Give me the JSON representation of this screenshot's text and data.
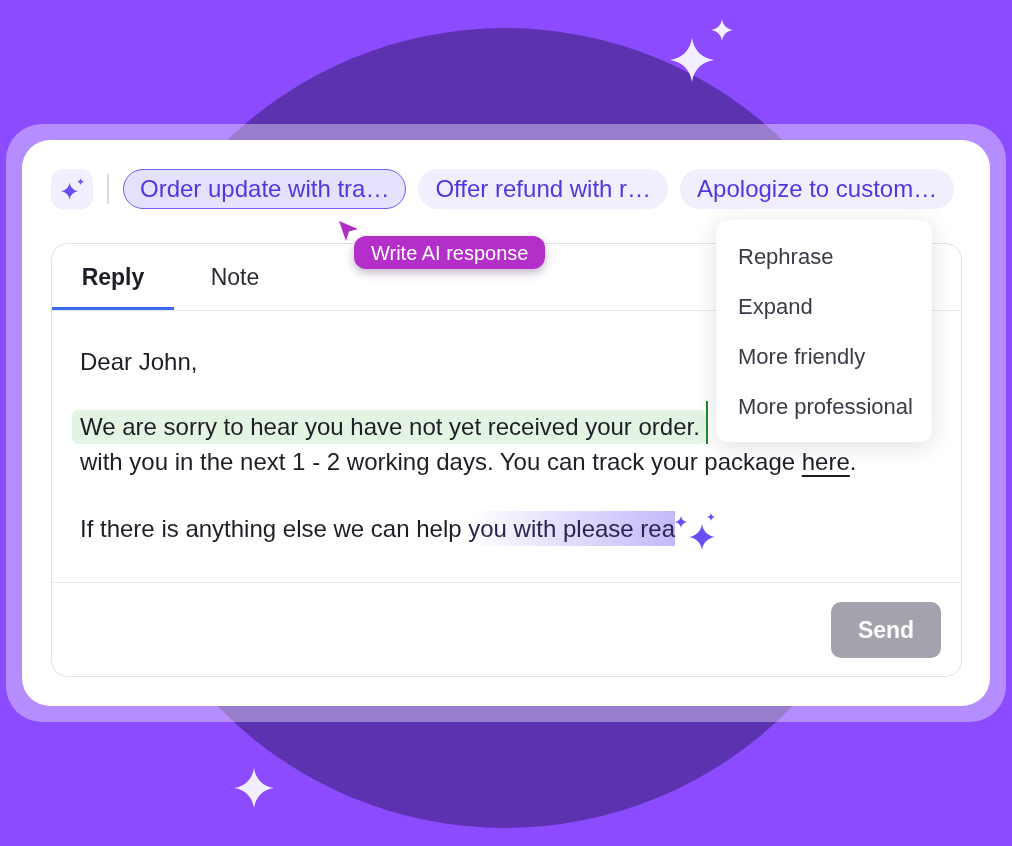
{
  "toolbar": {
    "suggestions": [
      {
        "label": "Order update with tra…",
        "selected": true
      },
      {
        "label": "Offer refund with r…",
        "selected": false
      },
      {
        "label": "Apologize to custom…",
        "selected": false
      }
    ]
  },
  "tooltip": {
    "text": "Write AI response"
  },
  "editor": {
    "tabs": [
      {
        "label": "Reply",
        "selected": true
      },
      {
        "label": "Note",
        "selected": false
      }
    ],
    "paragraphs": [
      {
        "lines": [
          {
            "kind": "plain",
            "text": "Dear John,"
          }
        ]
      },
      {
        "lines": [
          {
            "kind": "highlighted",
            "text": "We are sorry to hear you have not yet received your order.",
            "caret": true
          },
          {
            "kind": "link",
            "text": "with you in the next 1 - 2 working days. You can track your package ",
            "link": "here",
            "after": "."
          }
        ]
      },
      {
        "lines": [
          {
            "kind": "generating",
            "text": "If there is anything else we can help ",
            "generated": "you with please rea"
          }
        ]
      }
    ],
    "send_button": {
      "label": "Send",
      "disabled": true
    }
  },
  "menu": {
    "items": [
      "Rephrase",
      "Expand",
      "More friendly",
      "More professional"
    ]
  }
}
